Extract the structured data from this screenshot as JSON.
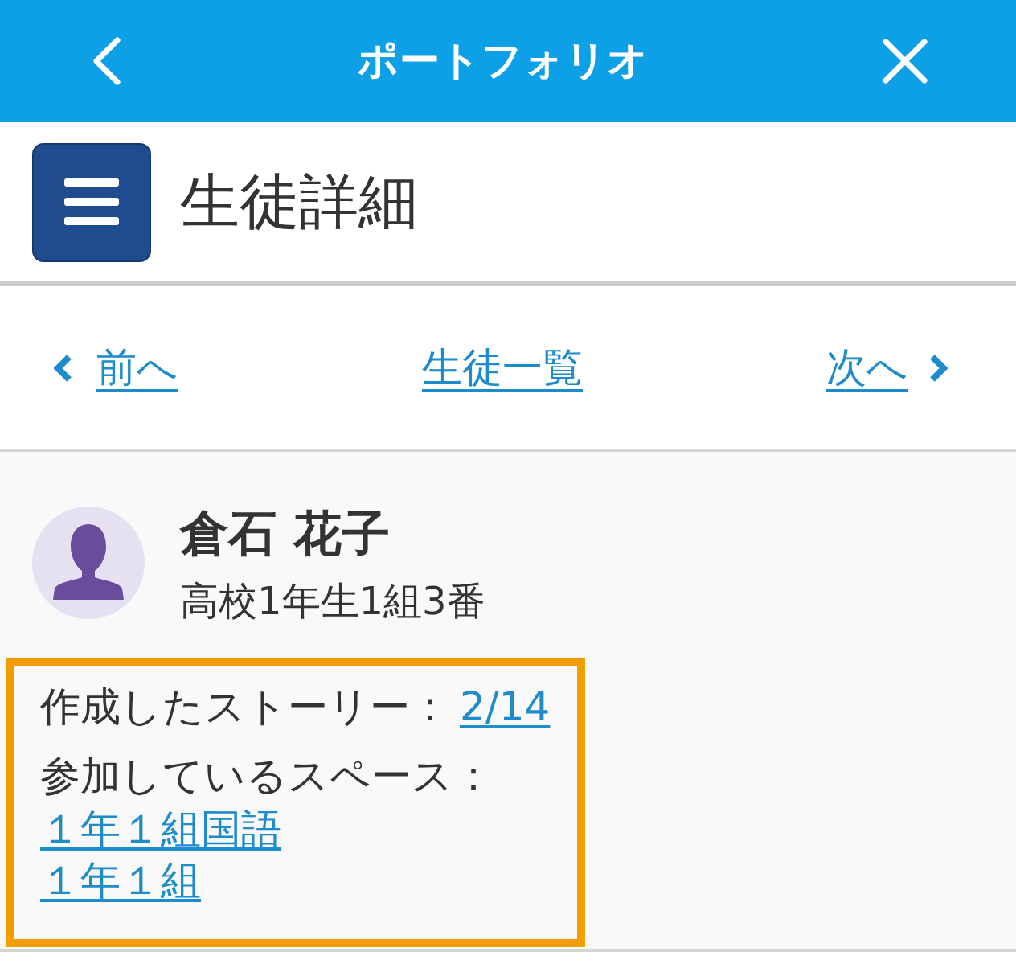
{
  "header": {
    "title": "ポートフォリオ"
  },
  "page": {
    "title": "生徒詳細"
  },
  "navigation": {
    "previous": "前へ",
    "list": "生徒一覧",
    "next": "次へ"
  },
  "student": {
    "name": "倉石 花子",
    "class": "高校1年生1組3番"
  },
  "details": {
    "highlighted": true,
    "stories_label": "作成したストーリー：",
    "stories_link": "2/14",
    "spaces_label": "参加しているスペース：",
    "spaces": [
      "１年１組国語",
      "１年１組"
    ]
  }
}
